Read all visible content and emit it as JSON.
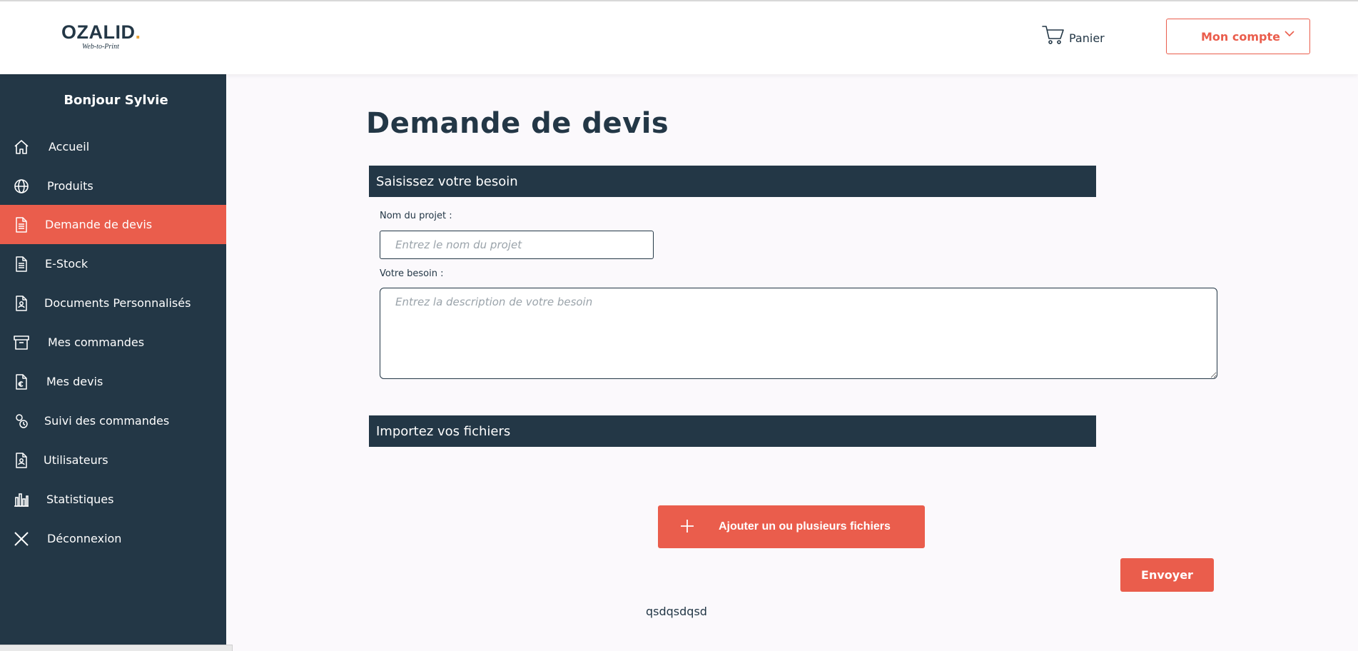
{
  "header": {
    "logo_text": "OZALID",
    "logo_dot": ".",
    "logo_sub": "Web-to-Print",
    "cart_label": "Panier",
    "account_label": "Mon compte"
  },
  "sidebar": {
    "greeting": "Bonjour Sylvie",
    "items": [
      {
        "label": "Accueil",
        "icon": "home-icon"
      },
      {
        "label": "Produits",
        "icon": "globe-icon"
      },
      {
        "label": "Demande de devis",
        "icon": "document-icon",
        "active": true
      },
      {
        "label": "E-Stock",
        "icon": "document-icon"
      },
      {
        "label": "Documents Personnalisés",
        "icon": "custom-document-icon"
      },
      {
        "label": "Mes commandes",
        "icon": "archive-box-icon"
      },
      {
        "label": "Mes devis",
        "icon": "euro-document-icon"
      },
      {
        "label": "Suivi des commandes",
        "icon": "tracking-icon"
      },
      {
        "label": "Utilisateurs",
        "icon": "user-document-icon"
      },
      {
        "label": "Statistiques",
        "icon": "bar-chart-icon"
      },
      {
        "label": "Déconnexion",
        "icon": "close-icon"
      }
    ]
  },
  "main": {
    "title": "Demande de devis",
    "section_need": "Saisissez votre besoin",
    "project_name_label": "Nom du projet :",
    "project_name_placeholder": "Entrez le nom du projet",
    "need_label": "Votre besoin :",
    "need_placeholder": "Entrez la description de votre besoin",
    "section_files": "Importez vos fichiers",
    "upload_label": "Ajouter un ou plusieurs fichiers",
    "send_label": "Envoyer",
    "footer_text": "qsdqsdqsd"
  },
  "colors": {
    "navy": "#233746",
    "accent": "#ea5d4c",
    "background": "#fbf9fc"
  }
}
